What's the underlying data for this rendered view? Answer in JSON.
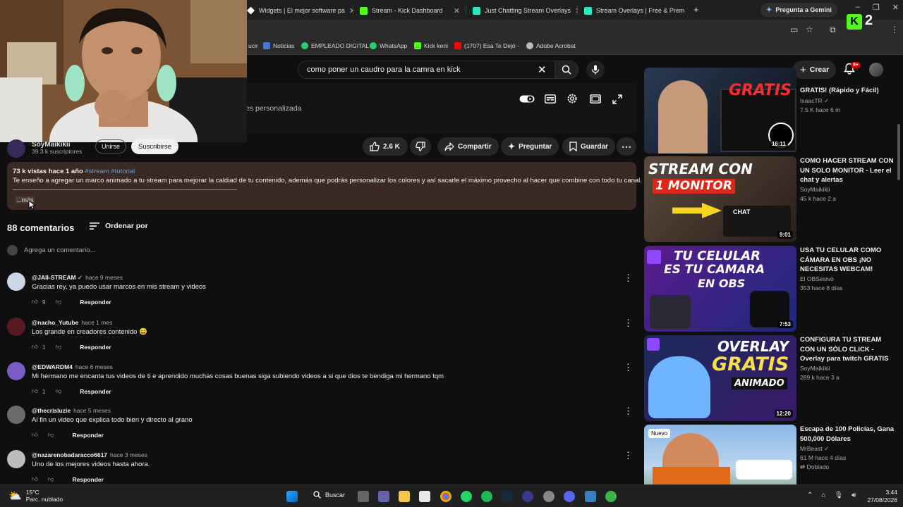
{
  "browser": {
    "tabs": [
      {
        "label": "Widgets | El mejor software pa",
        "color": "#ffffff"
      },
      {
        "label": "Stream - Kick Dashboard",
        "color": "#53fc18"
      },
      {
        "label": "Just Chatting Stream Overlays",
        "color": "#2ee6c0"
      },
      {
        "label": "Stream Overlays | Free & Prem",
        "color": "#2ee6c0"
      }
    ],
    "new_tab": "+",
    "gemini": "Pregunta a Gemini",
    "bookmarks": [
      {
        "label": "ucir",
        "color": "#2b2b2b"
      },
      {
        "label": "Noticias",
        "color": "#4a78d6"
      },
      {
        "label": "EMPLEADO DIGITAL",
        "color": "#2ecc71"
      },
      {
        "label": "WhatsApp",
        "color": "#25d366"
      },
      {
        "label": "Kick keni",
        "color": "#53fc18"
      },
      {
        "label": "(1707) Esa Te Dejó -",
        "color": "#ff0000"
      },
      {
        "label": "Adobe Acrobat",
        "color": "#bbbbbb"
      }
    ],
    "kick_overlay_number": "2"
  },
  "header": {
    "search_value": "como poner un caudro para la camra en kick",
    "create_label": "Crear",
    "notifications_badge": "9+"
  },
  "player": {
    "subtitle_fragment": "es personalizada"
  },
  "channel": {
    "name": "SoyMaikikii",
    "subscribers": "39.3 k suscriptores",
    "join_label": "Unirse",
    "subscribe_label": "Suscribirse"
  },
  "actions": {
    "likes": "2.6 K",
    "share": "Compartir",
    "ask": "Preguntar",
    "save": "Guardar"
  },
  "description": {
    "views_date": "73 k vistas  hace 1 año",
    "tags": "#stream #tutorial",
    "text": "Te enseño a agregar un marco animado a tu stream para mejorar la caldiad de tu contenido, además que podrás personalizar los colores y así sacarle el máximo provecho al hacer que combine con todo tu canal.",
    "more": "...más"
  },
  "comments": {
    "count_label": "88 comentarios",
    "sort_label": "Ordenar por",
    "add_placeholder": "Agrega un comentario...",
    "reply_label": "Responder",
    "items": [
      {
        "author": "@JAII-STREAM",
        "time": "hace 9 meses",
        "text": "Gracias rey, ya puedo usar marcos en mis stream y videos",
        "likes": "9",
        "avatar_color": "#c9d7e6"
      },
      {
        "author": "@nacho_Yutube",
        "time": "hace 1 mes",
        "text": "Los grande en creadores contenido 😄",
        "likes": "1",
        "avatar_color": "#5a1a22"
      },
      {
        "author": "@EDWARDM4",
        "time": "hace 6 meses",
        "text": "Mi hermano me encanta tus videos de ti e aprendido muchas cosas buenas siga subiendo videos a si que dios te bendiga mi hermano tqm",
        "likes": "1",
        "avatar_color": "#7b5cc4"
      },
      {
        "author": "@thecrisluzie",
        "time": "hace 5 meses",
        "text": "Al fin un video que explica todo bien y directo al grano",
        "likes": "",
        "avatar_color": "#6a6a6a"
      },
      {
        "author": "@nazarenobadaracco6617",
        "time": "hace 3 meses",
        "text": "Uno de los mejores videos hasta ahora.",
        "likes": "",
        "avatar_color": "#bcbcbc"
      }
    ]
  },
  "sidebar": {
    "items": [
      {
        "title": "GRATIS! (Rápido y Fácil)",
        "channel": "IsaacTR",
        "stats": "7.5 K  hace 6 m",
        "duration": "16:11",
        "thumb_text": "GRATIS",
        "verified": true
      },
      {
        "title": "COMO HACER STREAM CON UN SOLO MONITOR - Leer el chat y alertas",
        "channel": "SoyMaikikii",
        "stats": "45 k  hace 2 a",
        "duration": "9:01",
        "thumb_text": "STREAM CON",
        "thumb_text2": "1 MONITOR",
        "thumb_chat": "CHAT"
      },
      {
        "title": "USA TU CELULAR COMO CÁMARA EN OBS ¡NO NECESITAS WEBCAM!",
        "channel": "El OBSesivo",
        "stats": "353  hace 8 días",
        "duration": "7:53",
        "thumb_text": "TU CELULAR",
        "thumb_text2": "ES TU CAMARA",
        "thumb_text3": "EN OBS"
      },
      {
        "title": "CONFIGURA TU STREAM CON UN SÓLO CLICK - Overlay para twitch GRATIS",
        "channel": "SoyMaikikii",
        "stats": "289 k  hace 3 a",
        "duration": "12:20",
        "thumb_text": "OVERLAY",
        "thumb_text2": "GRATIS",
        "thumb_text3": "ANIMADO"
      },
      {
        "title": "Escapa de 100 Policías, Gana 500,000 Dólares",
        "channel": "MrBeast",
        "stats": "61 M  hace 4 días",
        "extra": "Doblado",
        "badge": "Nuevo",
        "verified": true
      }
    ]
  },
  "taskbar": {
    "temp": "15°C",
    "weather": "Parc. nublado",
    "search": "Buscar",
    "time": "3:44",
    "date": "27/08/2026"
  }
}
